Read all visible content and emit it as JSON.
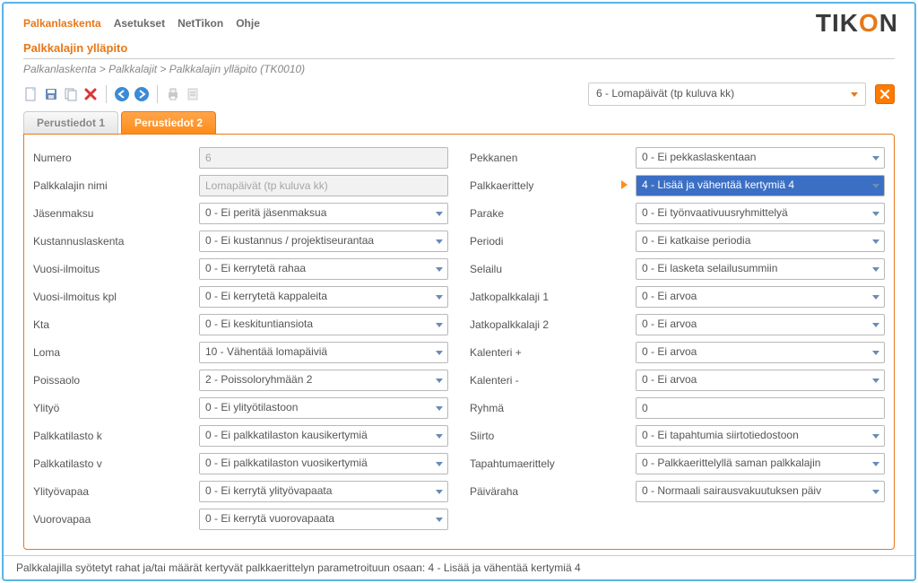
{
  "nav": {
    "items": [
      "Palkanlaskenta",
      "Asetukset",
      "NetTikon",
      "Ohje"
    ],
    "activeIndex": 0
  },
  "logo": {
    "t": "TIK",
    "o": "O",
    "n": "N"
  },
  "pageTitle": "Palkkalajin ylläpito",
  "breadcrumb": "Palkanlaskenta > Palkkalajit > Palkkalajin ylläpito  (TK0010)",
  "topDropdown": "6  -  Lomapäivät (tp kuluva kk)",
  "tabs": {
    "t1": "Perustiedot 1",
    "t2": "Perustiedot 2"
  },
  "left": {
    "numero": {
      "label": "Numero",
      "value": "6"
    },
    "nimi": {
      "label": "Palkkalajin nimi",
      "value": "Lomapäivät (tp kuluva kk)"
    },
    "jasenmaksu": {
      "label": "Jäsenmaksu",
      "value": "0 - Ei peritä jäsenmaksua"
    },
    "kustannus": {
      "label": "Kustannuslaskenta",
      "value": "0 - Ei kustannus / projektiseurantaa"
    },
    "vuosi": {
      "label": "Vuosi-ilmoitus",
      "value": "0 - Ei kerrytetä rahaa"
    },
    "vuosikpl": {
      "label": "Vuosi-ilmoitus kpl",
      "value": "0 - Ei kerrytetä kappaleita"
    },
    "kta": {
      "label": "Kta",
      "value": "0 - Ei keskituntiansiota"
    },
    "loma": {
      "label": "Loma",
      "value": "10 - Vähentää lomapäiviä"
    },
    "poissaolo": {
      "label": "Poissaolo",
      "value": "2 - Poissoloryhmään 2"
    },
    "ylityo": {
      "label": "Ylityö",
      "value": "0 - Ei ylityötilastoon"
    },
    "ptk": {
      "label": "Palkkatilasto k",
      "value": "0 - Ei palkkatilaston kausikertymiä"
    },
    "ptv": {
      "label": "Palkkatilasto v",
      "value": "0 - Ei palkkatilaston vuosikertymiä"
    },
    "ylityovapaa": {
      "label": "Ylityövapaa",
      "value": "0 - Ei kerrytä ylityövapaata"
    },
    "vuorovapaa": {
      "label": "Vuorovapaa",
      "value": "0 - Ei kerrytä vuorovapaata"
    }
  },
  "right": {
    "pekkanen": {
      "label": "Pekkanen",
      "value": "0 - Ei pekkaslaskentaan"
    },
    "palkkaerittely": {
      "label": "Palkkaerittely",
      "value": "4 - Lisää ja vähentää kertymiä 4"
    },
    "parake": {
      "label": "Parake",
      "value": "0 - Ei työnvaativuusryhmittelyä"
    },
    "periodi": {
      "label": "Periodi",
      "value": "0 - Ei katkaise periodia"
    },
    "selailu": {
      "label": "Selailu",
      "value": "0 - Ei lasketa selailusummiin"
    },
    "jatko1": {
      "label": "Jatkopalkkalaji 1",
      "value": "0 -  Ei arvoa"
    },
    "jatko2": {
      "label": "Jatkopalkkalaji 2",
      "value": "0 -  Ei arvoa"
    },
    "kalplus": {
      "label": "Kalenteri +",
      "value": "0 -  Ei arvoa"
    },
    "kalminus": {
      "label": "Kalenteri -",
      "value": "0 -  Ei arvoa"
    },
    "ryhma": {
      "label": "Ryhmä",
      "value": "0"
    },
    "siirto": {
      "label": "Siirto",
      "value": "0 - Ei tapahtumia siirtotiedostoon"
    },
    "tapahtuma": {
      "label": "Tapahtumaerittely",
      "value": "0 - Palkkaerittelyllä saman palkkalajin"
    },
    "paivaraha": {
      "label": "Päiväraha",
      "value": "0 - Normaali sairausvakuutuksen päiv"
    }
  },
  "status": "Palkkalajilla syötetyt rahat ja/tai määrät kertyvät palkkaerittelyn parametroituun osaan: 4 - Lisää ja vähentää kertymiä 4"
}
